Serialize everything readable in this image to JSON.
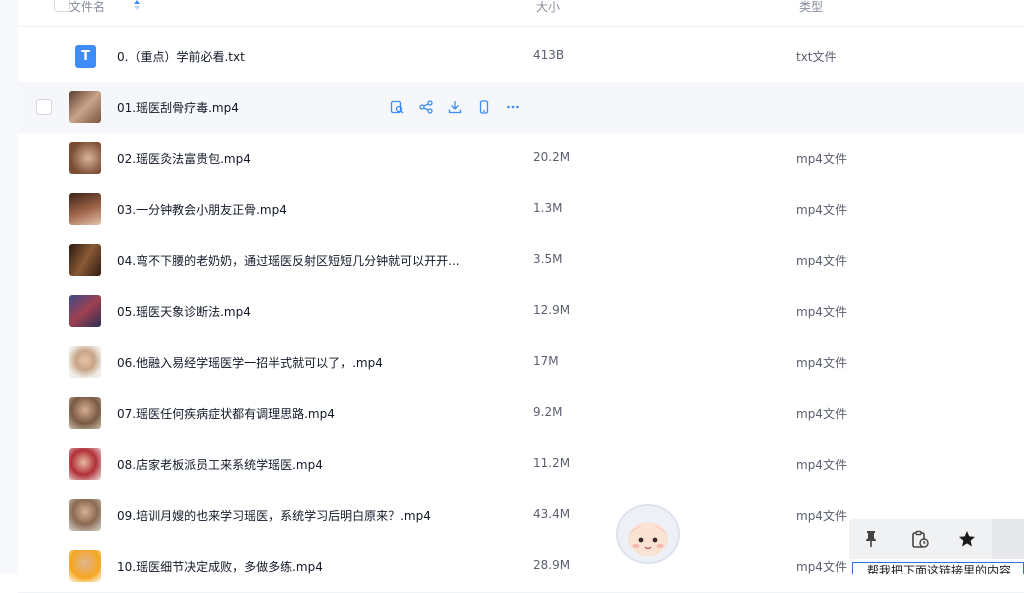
{
  "header": {
    "name": "文件名",
    "size": "大小",
    "type": "类型"
  },
  "rows": [
    {
      "name": "0.（重点）学前必看.txt",
      "size": "413B",
      "type": "txt文件",
      "icon": "T"
    },
    {
      "name": "01.瑶医刮骨疗毒.mp4",
      "size": "",
      "type": ""
    },
    {
      "name": "02.瑶医灸法富贵包.mp4",
      "size": "20.2M",
      "type": "mp4文件"
    },
    {
      "name": "03.一分钟教会小朋友正骨.mp4",
      "size": "1.3M",
      "type": "mp4文件"
    },
    {
      "name": "04.弯不下腰的老奶奶，通过瑶医反射区短短几分钟就可以开开...",
      "size": "3.5M",
      "type": "mp4文件"
    },
    {
      "name": "05.瑶医天象诊断法.mp4",
      "size": "12.9M",
      "type": "mp4文件"
    },
    {
      "name": "06.他融入易经学瑶医学一招半式就可以了，.mp4",
      "size": "17M",
      "type": "mp4文件"
    },
    {
      "name": "07.瑶医任何疾病症状都有调理思路.mp4",
      "size": "9.2M",
      "type": "mp4文件"
    },
    {
      "name": "08.店家老板派员工来系统学瑶医.mp4",
      "size": "11.2M",
      "type": "mp4文件"
    },
    {
      "name": "09.培训月嫂的也来学习瑶医，系统学习后明白原来？.mp4",
      "size": "43.4M",
      "type": "mp4文件"
    },
    {
      "name": "10.瑶医细节决定成败，多做多练.mp4",
      "size": "28.9M",
      "type": "mp4文件"
    }
  ],
  "input_text": "帮我把下面这链接里的内容",
  "colors": {
    "accent": "#3d8cf7",
    "hover": "#f5f7fb"
  }
}
